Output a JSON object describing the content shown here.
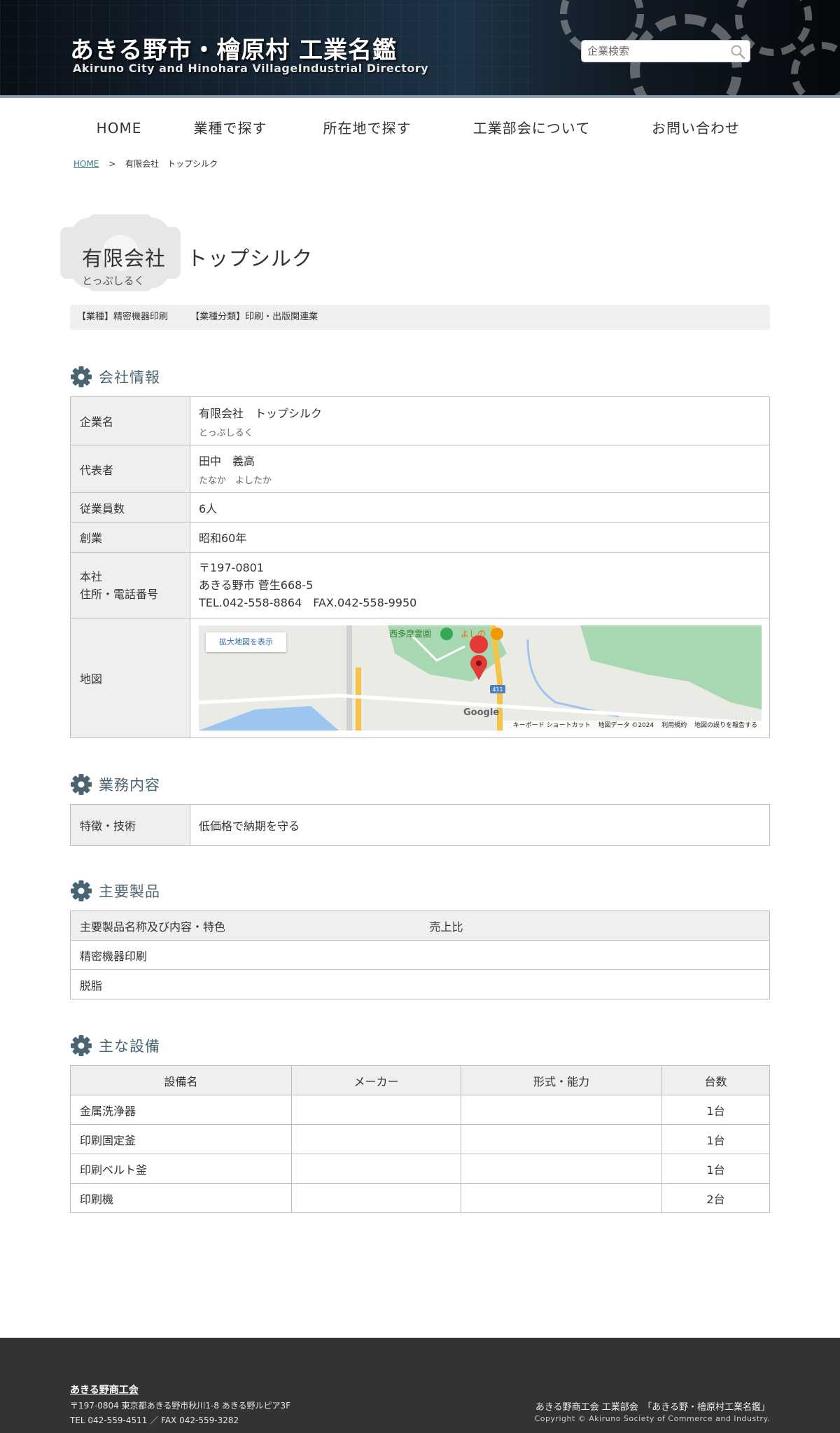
{
  "header": {
    "title": "あきる野市・檜原村 工業名鑑",
    "subtitle": "Akiruno City and Hinohara VillageIndustrial Directory",
    "search_placeholder": "企業検索"
  },
  "nav": {
    "items": [
      "HOME",
      "業種で探す",
      "所在地で探す",
      "工業部会について",
      "お問い合わせ"
    ]
  },
  "breadcrumb": {
    "home": "HOME",
    "separator": ">",
    "current": "有限会社　トップシルク"
  },
  "company": {
    "name": "有限会社　トップシルク",
    "kana": "とっぷしるく",
    "industry": "【業種】精密機器印刷",
    "category": "【業種分類】印刷・出版関連業"
  },
  "sections": {
    "company_info": "会社情報",
    "business": "業務内容",
    "products": "主要製品",
    "equipment": "主な設備"
  },
  "info": {
    "name_label": "企業名",
    "name": "有限会社　トップシルク",
    "name_kana": "とっぷしるく",
    "rep_label": "代表者",
    "rep": "田中　義高",
    "rep_kana": "たなか　よしたか",
    "employees_label": "従業員数",
    "employees": "6人",
    "founded_label": "創業",
    "founded": "昭和60年",
    "hq_label_1": "本社",
    "hq_label_2": "住所・電話番号",
    "postal": "〒197-0801",
    "address": "あきる野市 菅生668-5",
    "phone": "TEL.042-558-8864　FAX.042-558-9950",
    "map_label": "地図"
  },
  "map": {
    "enlarge_button": "拡大地図を表示",
    "place_1": "西多摩霊園",
    "place_2": "よしの",
    "road_label": "411",
    "logo": "Google",
    "footer_1": "キーボード ショートカット",
    "footer_2": "地図データ ©2024",
    "footer_3": "利用規約",
    "footer_4": "地図の誤りを報告する",
    "water_color": "#9cc5f0",
    "park_color": "#a8d8b1",
    "road_color": "#f4c34a",
    "marker_color": "#e53935"
  },
  "business": {
    "label": "特徴・技術",
    "value": "低価格で納期を守る"
  },
  "products": {
    "headers": [
      "主要製品名称及び内容・特色",
      "売上比"
    ],
    "rows": [
      [
        "精密機器印刷",
        ""
      ],
      [
        "脱脂",
        ""
      ]
    ]
  },
  "equipment": {
    "headers": [
      "設備名",
      "メーカー",
      "形式・能力",
      "台数"
    ],
    "rows": [
      [
        "金属洗浄器",
        "",
        "",
        "1台"
      ],
      [
        "印刷固定釜",
        "",
        "",
        "1台"
      ],
      [
        "印刷ベルト釜",
        "",
        "",
        "1台"
      ],
      [
        "印刷機",
        "",
        "",
        "2台"
      ]
    ]
  },
  "footer": {
    "org": "あきる野商工会",
    "address": "〒197-0804 東京都あきる野市秋川1-8 あきる野ルピア3F",
    "tel": "TEL 042-559-4511 ／ FAX 042-559-3282",
    "right_line": "あきる野商工会 工業部会　「あきる野・檜原村工業名鑑」",
    "copyright": "Copyright © Akiruno Society of Commerce and Industry."
  },
  "colors": {
    "accent": "#4a6472",
    "header_bg": "#152433",
    "footer_bg": "#333333",
    "label_bg": "#efefef"
  }
}
